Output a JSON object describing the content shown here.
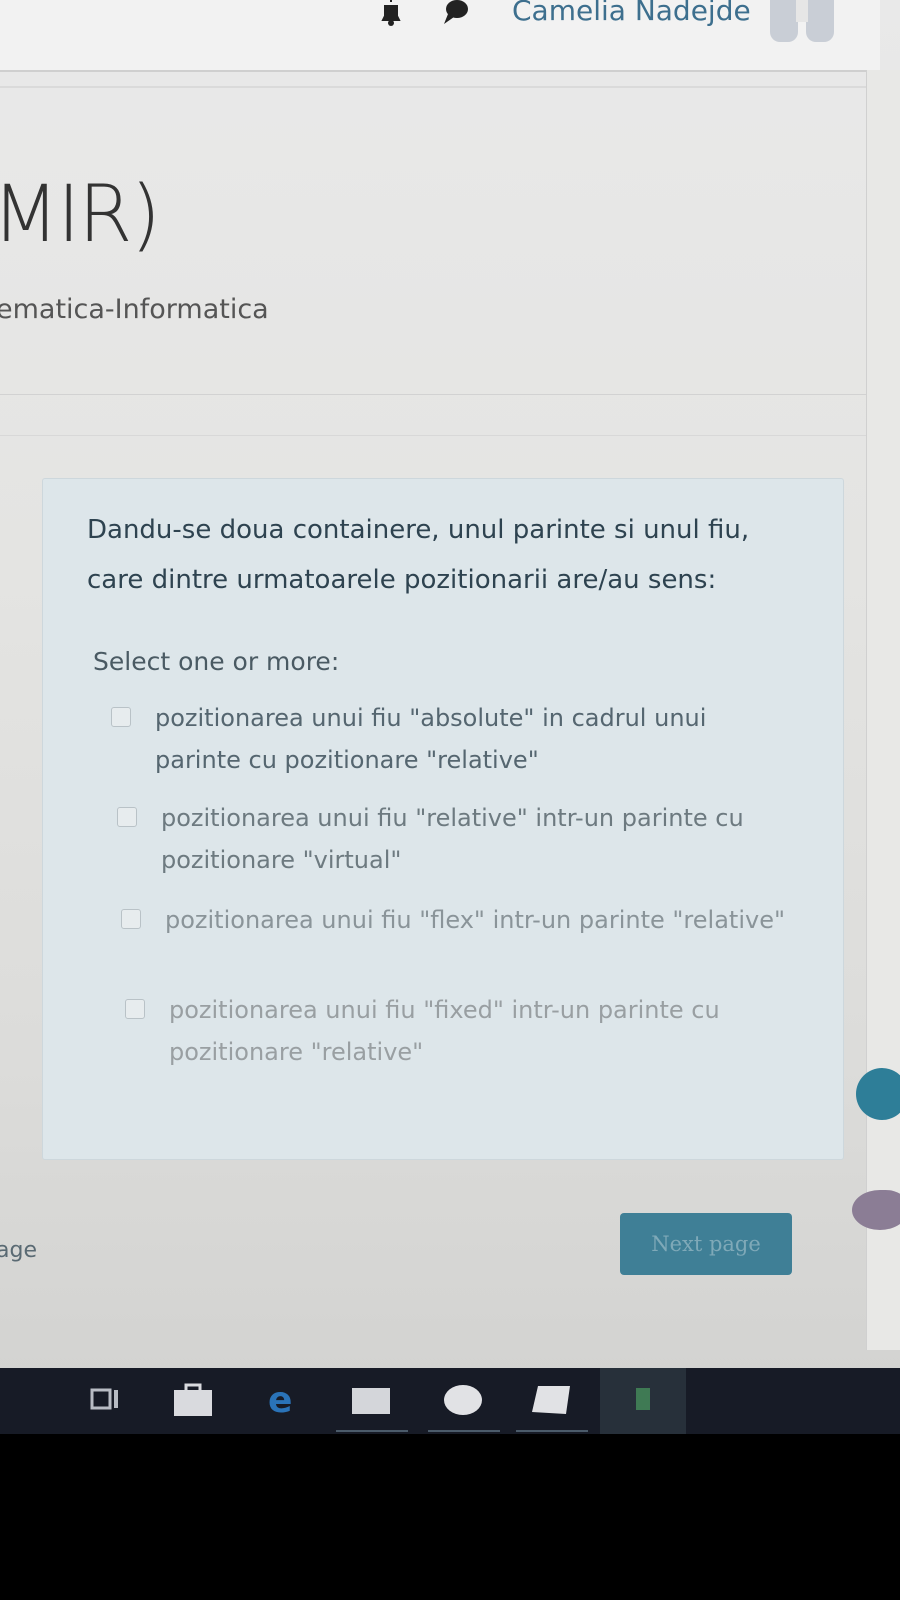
{
  "navbar": {
    "user_name": "Camelia Nadejde",
    "icons": [
      "bell-icon",
      "chat-icon",
      "avatar"
    ]
  },
  "course": {
    "title": "MIR)",
    "subtitle": "ematica-Informatica"
  },
  "question": {
    "text": "Dandu-se doua containere, unul parinte si unul fiu, care dintre urmatoarele pozitionarii are/au sens:",
    "prompt": "Select one or more:",
    "options": [
      {
        "label": "pozitionarea unui fiu \"absolute\" in cadrul unui parinte cu pozitionare \"relative\""
      },
      {
        "label": "pozitionarea unui fiu \"relative\" intr-un parinte cu pozitionare \"virtual\""
      },
      {
        "label": "pozitionarea unui fiu \"flex\" intr-un parinte \"relative\""
      },
      {
        "label": "pozitionarea unui fiu \"fixed\" intr-un parinte cu pozitionare \"relative\""
      }
    ]
  },
  "navigation": {
    "previous_label": "age",
    "next_label": "Next page"
  },
  "taskbar": {
    "icons": [
      "task-view-icon",
      "store-icon",
      "edge-icon",
      "file-explorer-icon",
      "app-circle-icon",
      "app-shape-icon",
      "active-app-icon"
    ]
  },
  "colors": {
    "accent": "#3f7f96",
    "link": "#3d6f8e"
  }
}
